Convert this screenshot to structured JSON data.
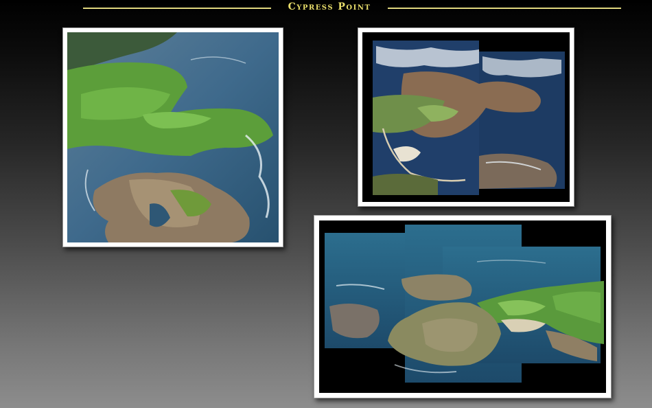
{
  "header": {
    "title": "Cypress Point",
    "rule_color": "#e2d97f",
    "title_color": "#e8dd6a"
  },
  "photos": [
    {
      "icon": "aerial-photo-coastal-golf-course"
    },
    {
      "icon": "aerial-photo-collage-golf-course"
    },
    {
      "icon": "aerial-photo-collage-ocean-hole"
    }
  ],
  "colors": {
    "background_top": "#000000",
    "background_bottom": "#8d8d8d",
    "frame": "#ffffff",
    "ocean": "#2f5e83",
    "fairway": "#5c9e3a",
    "rock": "#8e7a62"
  }
}
